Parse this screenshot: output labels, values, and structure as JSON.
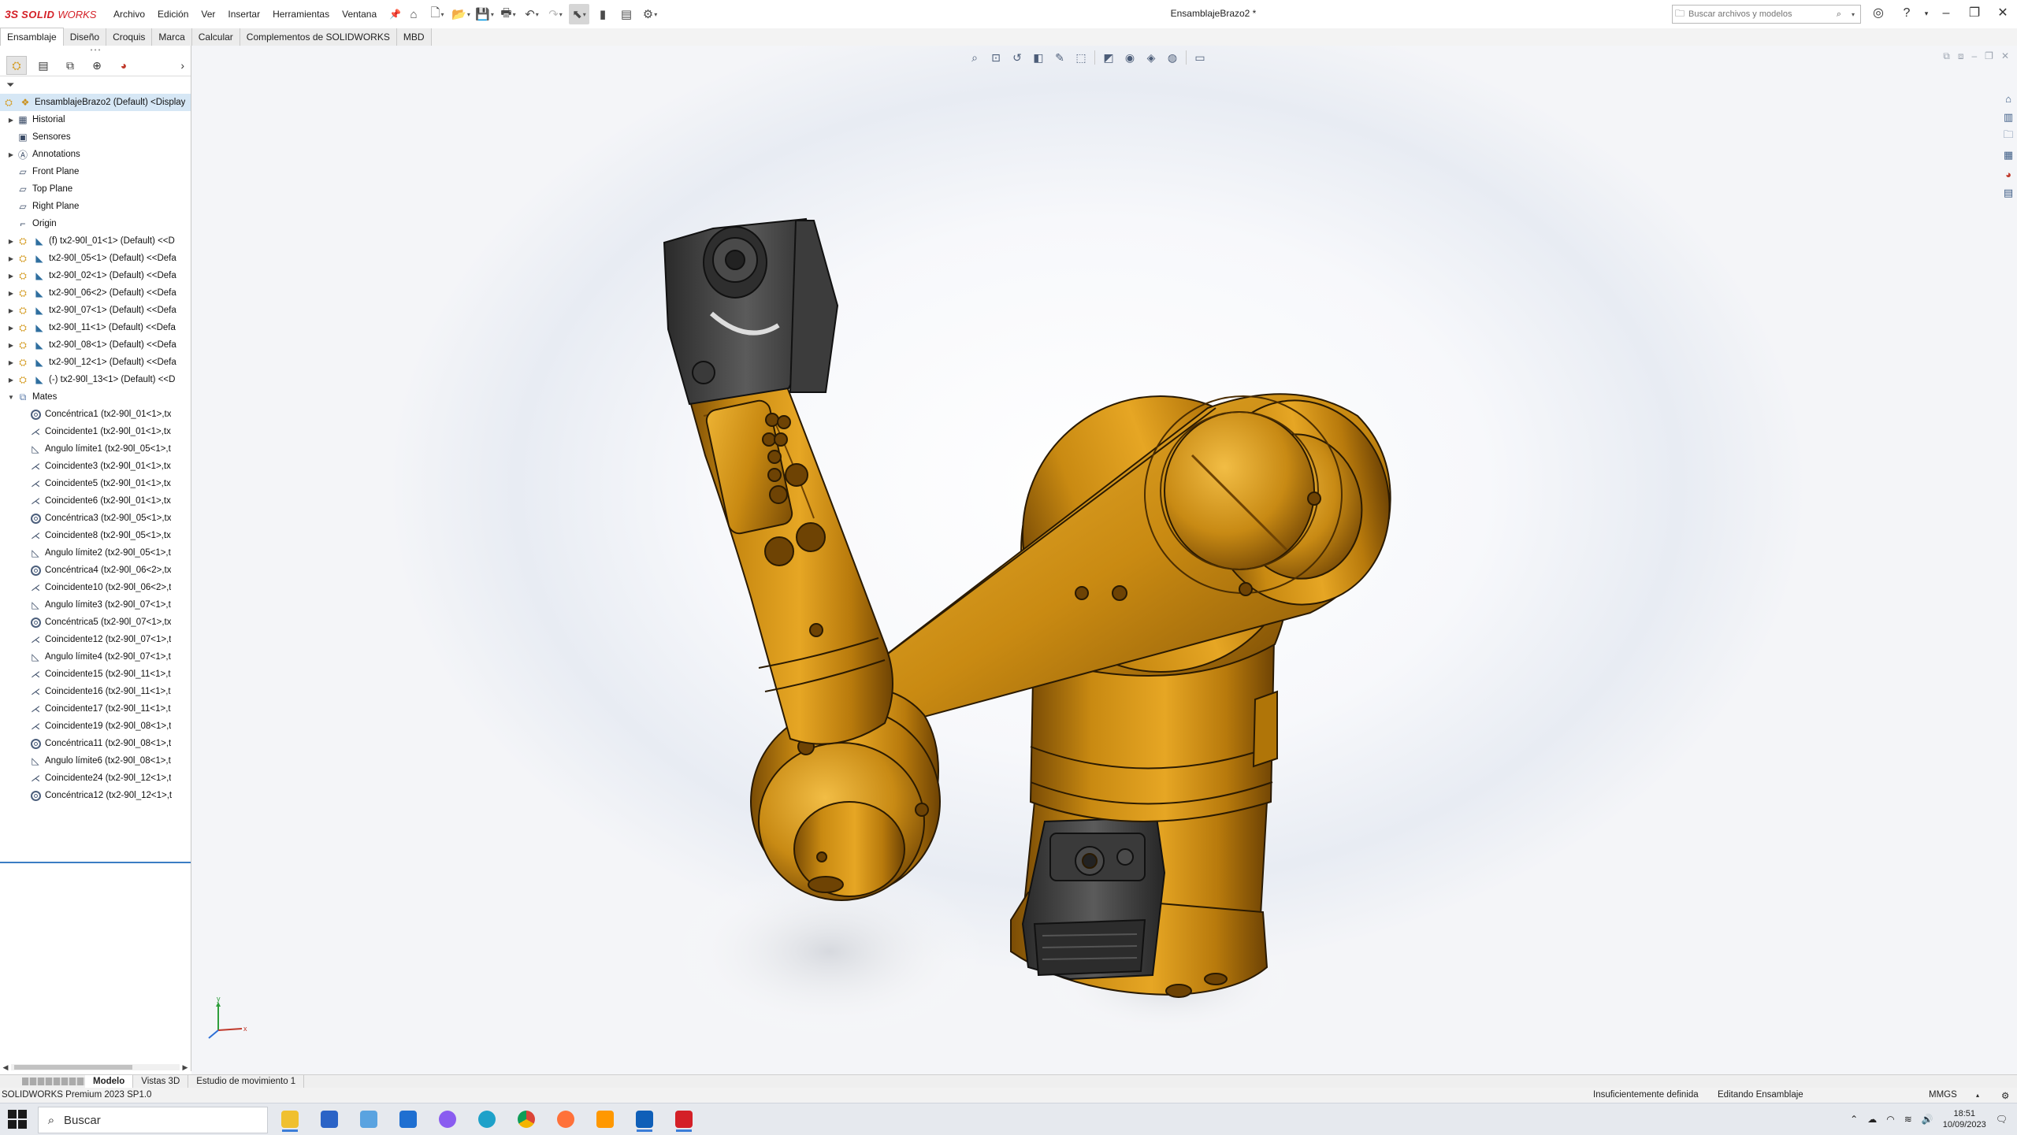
{
  "app": {
    "logo_ds": "3S",
    "logo_solid": "SOLID",
    "logo_works": "WORKS",
    "document_title": "EnsamblajeBrazo2 *"
  },
  "menu": [
    "Archivo",
    "Edición",
    "Ver",
    "Insertar",
    "Herramientas",
    "Ventana"
  ],
  "search": {
    "placeholder": "Buscar archivos y modelos"
  },
  "command_tabs": [
    "Ensamblaje",
    "Diseño",
    "Croquis",
    "Marca",
    "Calcular",
    "Complementos de SOLIDWORKS",
    "MBD"
  ],
  "tree": {
    "root": "EnsamblajeBrazo2 (Default) <Display",
    "folders": [
      "Historial",
      "Sensores",
      "Annotations",
      "Front Plane",
      "Top Plane",
      "Right Plane",
      "Origin"
    ],
    "components": [
      "(f) tx2-90l_01<1> (Default) <<D",
      "tx2-90l_05<1> (Default) <<Defa",
      "tx2-90l_02<1> (Default) <<Defa",
      "tx2-90l_06<2> (Default) <<Defa",
      "tx2-90l_07<1> (Default) <<Defa",
      "tx2-90l_11<1> (Default) <<Defa",
      "tx2-90l_08<1> (Default) <<Defa",
      "tx2-90l_12<1> (Default) <<Defa",
      "(-) tx2-90l_13<1> (Default) <<D"
    ],
    "mates_label": "Mates",
    "mates": [
      {
        "type": "concentric",
        "label": "Concéntrica1 (tx2-90l_01<1>,tx"
      },
      {
        "type": "coincident",
        "label": "Coincidente1 (tx2-90l_01<1>,tx"
      },
      {
        "type": "angle",
        "label": "Ángulo límite1 (tx2-90l_05<1>,t"
      },
      {
        "type": "coincident",
        "label": "Coincidente3 (tx2-90l_01<1>,tx"
      },
      {
        "type": "coincident",
        "label": "Coincidente5 (tx2-90l_01<1>,tx"
      },
      {
        "type": "coincident",
        "label": "Coincidente6 (tx2-90l_01<1>,tx"
      },
      {
        "type": "concentric",
        "label": "Concéntrica3 (tx2-90l_05<1>,tx"
      },
      {
        "type": "coincident",
        "label": "Coincidente8 (tx2-90l_05<1>,tx"
      },
      {
        "type": "angle",
        "label": "Ángulo límite2 (tx2-90l_05<1>,t"
      },
      {
        "type": "concentric",
        "label": "Concéntrica4 (tx2-90l_06<2>,tx"
      },
      {
        "type": "coincident",
        "label": "Coincidente10 (tx2-90l_06<2>,t"
      },
      {
        "type": "angle",
        "label": "Ángulo límite3 (tx2-90l_07<1>,t"
      },
      {
        "type": "concentric",
        "label": "Concéntrica5 (tx2-90l_07<1>,tx"
      },
      {
        "type": "coincident",
        "label": "Coincidente12 (tx2-90l_07<1>,t"
      },
      {
        "type": "angle",
        "label": "Ángulo límite4 (tx2-90l_07<1>,t"
      },
      {
        "type": "coincident",
        "label": "Coincidente15 (tx2-90l_11<1>,t"
      },
      {
        "type": "coincident",
        "label": "Coincidente16 (tx2-90l_11<1>,t"
      },
      {
        "type": "coincident",
        "label": "Coincidente17 (tx2-90l_11<1>,t"
      },
      {
        "type": "coincident",
        "label": "Coincidente19 (tx2-90l_08<1>,t"
      },
      {
        "type": "concentric",
        "label": "Concéntrica11 (tx2-90l_08<1>,t"
      },
      {
        "type": "angle",
        "label": "Ángulo límite6 (tx2-90l_08<1>,t"
      },
      {
        "type": "coincident",
        "label": "Coincidente24 (tx2-90l_12<1>,t"
      },
      {
        "type": "concentric",
        "label": "Concéntrica12 (tx2-90l_12<1>,t"
      }
    ]
  },
  "bottom_tabs": [
    "Modelo",
    "Vistas 3D",
    "Estudio de movimiento 1"
  ],
  "status": {
    "product": "SOLIDWORKS Premium 2023 SP1.0",
    "definition": "Insuficientemente definida",
    "mode": "Editando Ensamblaje",
    "units": "MMGS"
  },
  "taskbar": {
    "search_placeholder": "Buscar",
    "time": "18:51",
    "date": "10/09/2023"
  },
  "colors": {
    "model_orange": "#d4910f",
    "model_dark": "#2e2e2e",
    "accent_blue": "#3b7dc4",
    "logo_red": "#d42027"
  }
}
